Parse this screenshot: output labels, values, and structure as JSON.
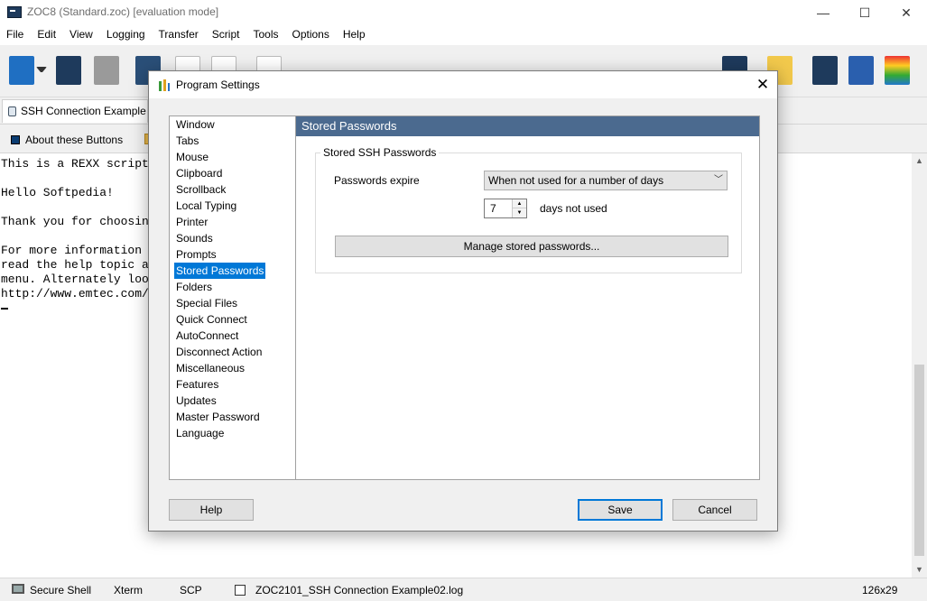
{
  "window": {
    "title": "ZOC8 (Standard.zoc) [evaluation mode]",
    "minimize_glyph": "—",
    "maximize_glyph": "☐",
    "close_glyph": "✕"
  },
  "menu": [
    "File",
    "Edit",
    "View",
    "Logging",
    "Transfer",
    "Script",
    "Tools",
    "Options",
    "Help"
  ],
  "session_tab": {
    "label": "SSH Connection Example"
  },
  "user_buttons": {
    "about_label": "About these Buttons"
  },
  "terminal": {
    "lines": [
      "This is a REXX script",
      "",
      "Hello Softpedia!",
      "",
      "Thank you for choosin",
      "",
      "For more information",
      "read the help topic a",
      "menu. Alternately loo",
      "http://www.emtec.com/"
    ]
  },
  "statusbar": {
    "protocol": "Secure Shell",
    "emulation": "Xterm",
    "transfer": "SCP",
    "logfile": "ZOC2101_SSH Connection Example02.log",
    "size": "126x29"
  },
  "dialog": {
    "title": "Program Settings",
    "close_glyph": "✕",
    "categories": [
      "Window",
      "Tabs",
      "Mouse",
      "Clipboard",
      "Scrollback",
      "Local Typing",
      "Printer",
      "Sounds",
      "Prompts",
      "Stored Passwords",
      "Folders",
      "Special Files",
      "Quick Connect",
      "AutoConnect",
      "Disconnect Action",
      "Miscellaneous",
      "Features",
      "Updates",
      "Master Password",
      "Language"
    ],
    "selected_category": "Stored Passwords",
    "panel_title": "Stored Passwords",
    "group_title": "Stored SSH Passwords",
    "expire_label": "Passwords expire",
    "expire_value": "When not used for a number of days",
    "days_value": "7",
    "days_label": "days not used",
    "manage_button": "Manage stored passwords...",
    "help_button": "Help",
    "save_button": "Save",
    "cancel_button": "Cancel"
  },
  "colors": {
    "accent": "#0078d7",
    "panel_header": "#4b6a8f",
    "dialog_bg": "#f0f0f0"
  }
}
